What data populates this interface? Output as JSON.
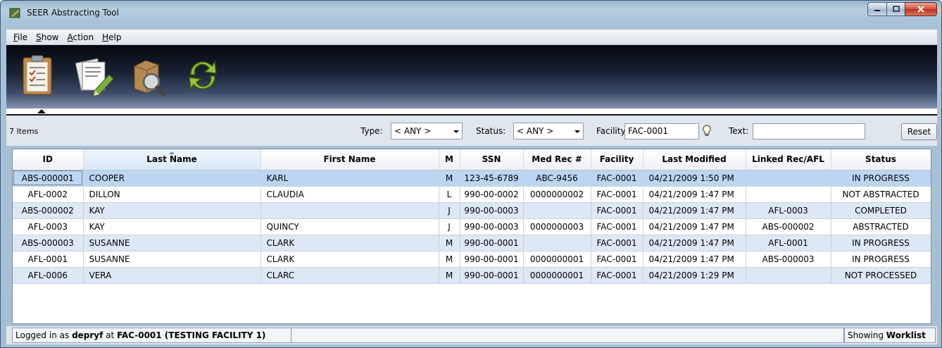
{
  "window": {
    "title": "SEER Abstracting Tool"
  },
  "menu": [
    {
      "label": "File",
      "mnemonic": "F",
      "rest": "ile"
    },
    {
      "label": "Show",
      "mnemonic": "S",
      "rest": "how"
    },
    {
      "label": "Action",
      "mnemonic": "A",
      "rest": "ction"
    },
    {
      "label": "Help",
      "mnemonic": "H",
      "rest": "elp"
    }
  ],
  "toolbar": {
    "icons": [
      "clipboard-worklist-icon",
      "edit-document-icon",
      "search-records-icon",
      "refresh-icon"
    ]
  },
  "filter": {
    "item_count": "7 Items",
    "type_label": "Type:",
    "type_value": "< ANY >",
    "status_label": "Status:",
    "status_value": "< ANY >",
    "facility_label": "Facility:",
    "facility_value": "FAC-0001",
    "text_label": "Text:",
    "text_value": "",
    "reset_label": "Reset"
  },
  "table": {
    "columns": [
      "ID",
      "Last Name",
      "First Name",
      "M",
      "SSN",
      "Med Rec #",
      "Facility",
      "Last Modified",
      "Linked Rec/AFL",
      "Status"
    ],
    "sorted_column": "Last Name",
    "rows": [
      [
        "ABS-000001",
        "COOPER",
        "KARL",
        "M",
        "123-45-6789",
        "ABC-9456",
        "FAC-0001",
        "04/21/2009 1:50 PM",
        "",
        "IN PROGRESS"
      ],
      [
        "AFL-0002",
        "DILLON",
        "CLAUDIA",
        "L",
        "990-00-0002",
        "0000000002",
        "FAC-0001",
        "04/21/2009 1:47 PM",
        "",
        "NOT ABSTRACTED"
      ],
      [
        "ABS-000002",
        "KAY",
        "",
        "J",
        "990-00-0003",
        "",
        "FAC-0001",
        "04/21/2009 1:47 PM",
        "AFL-0003",
        "COMPLETED"
      ],
      [
        "AFL-0003",
        "KAY",
        "QUINCY",
        "J",
        "990-00-0003",
        "0000000003",
        "FAC-0001",
        "04/21/2009 1:47 PM",
        "ABS-000002",
        "ABSTRACTED"
      ],
      [
        "ABS-000003",
        "SUSANNE",
        "CLARK",
        "M",
        "990-00-0001",
        "",
        "FAC-0001",
        "04/21/2009 1:47 PM",
        "AFL-0001",
        "IN PROGRESS"
      ],
      [
        "AFL-0001",
        "SUSANNE",
        "CLARK",
        "M",
        "990-00-0001",
        "0000000001",
        "FAC-0001",
        "04/21/2009 1:47 PM",
        "ABS-000003",
        "IN PROGRESS"
      ],
      [
        "AFL-0006",
        "VERA",
        "CLARC",
        "M",
        "990-00-0001",
        "0000000001",
        "FAC-0001",
        "04/21/2009 1:29 PM",
        "",
        "NOT PROCESSED"
      ]
    ]
  },
  "status": {
    "logged_prefix": "Logged in as",
    "user": "depryf",
    "at": "at",
    "facility": "FAC-0001 (TESTING FACILITY 1)",
    "showing_prefix": "Showing",
    "showing_value": "Worklist"
  }
}
